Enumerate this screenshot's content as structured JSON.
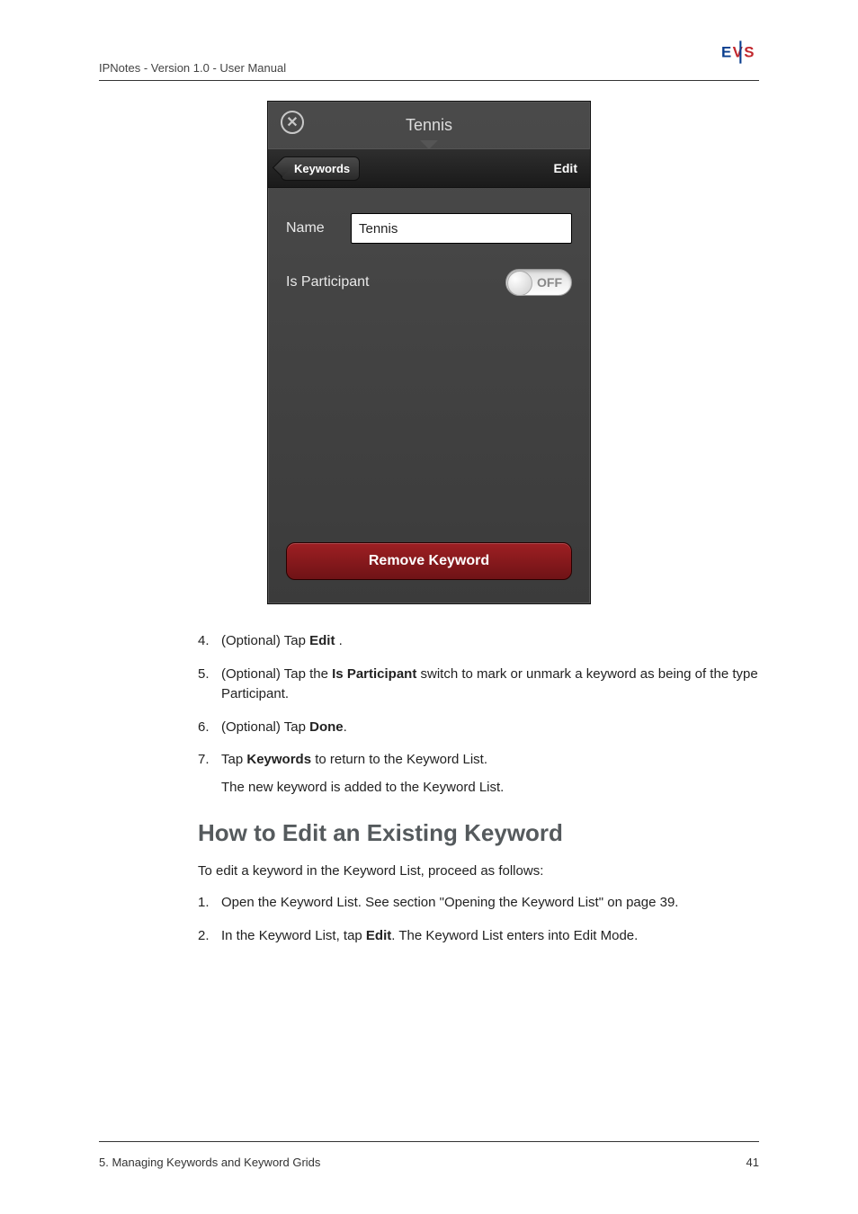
{
  "header": {
    "doc_title": "IPNotes - Version 1.0 - User Manual"
  },
  "logo": {
    "text1": "E",
    "text2": "V",
    "text3": "S"
  },
  "device": {
    "title": "Tennis",
    "back_label": "Keywords",
    "edit_label": "Edit",
    "name_label": "Name",
    "name_value": "Tennis",
    "participant_label": "Is Participant",
    "toggle_state": "OFF",
    "remove_label": "Remove Keyword"
  },
  "steps_a": {
    "s4_pre": "(Optional) Tap ",
    "s4_bold": "Edit",
    "s4_post": " .",
    "s5_pre": "(Optional) Tap the ",
    "s5_bold": "Is Participant",
    "s5_post": " switch to mark or unmark a keyword as being of the type Participant.",
    "s6_pre": "(Optional) Tap ",
    "s6_bold": "Done",
    "s6_post": ".",
    "s7_pre": "Tap ",
    "s7_bold": "Keywords",
    "s7_post": " to return to the Keyword List.",
    "s7_sub": "The new keyword is added to the Keyword List."
  },
  "section": {
    "heading": "How to Edit an Existing Keyword",
    "intro": "To edit a keyword in the Keyword List, proceed as follows:"
  },
  "steps_b": {
    "s1": "Open the Keyword List. See section \"Opening the Keyword List\" on page 39.",
    "s2_pre": "In the Keyword List, tap ",
    "s2_bold": "Edit",
    "s2_post": ".",
    "s2_sub": "The Keyword List enters into Edit Mode."
  },
  "footer": {
    "left": "5. Managing Keywords and Keyword Grids",
    "right": "41"
  }
}
